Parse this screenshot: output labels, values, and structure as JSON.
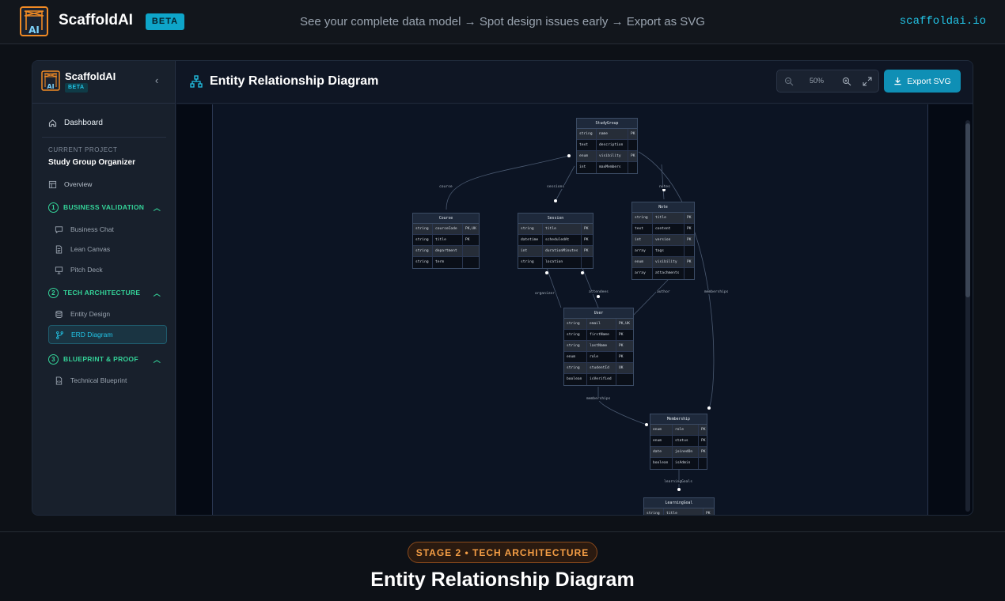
{
  "topbar": {
    "brand": "ScaffoldAI",
    "badge": "BETA",
    "tagline": "See your complete data model → Spot design issues early → Export as SVG",
    "site": "scaffoldai.io"
  },
  "sidebar": {
    "brand": "ScaffoldAI",
    "badge": "BETA",
    "dashboard": "Dashboard",
    "current_project_label": "CURRENT PROJECT",
    "project_name": "Study Group Organizer",
    "overview": "Overview",
    "sections": [
      {
        "num": "1",
        "label": "BUSINESS VALIDATION",
        "items": [
          "Business Chat",
          "Lean Canvas",
          "Pitch Deck"
        ]
      },
      {
        "num": "2",
        "label": "TECH ARCHITECTURE",
        "items": [
          "Entity Design",
          "ERD Diagram"
        ]
      },
      {
        "num": "3",
        "label": "BLUEPRINT & PROOF",
        "items": [
          "Technical Blueprint"
        ]
      }
    ],
    "active_item": "ERD Diagram"
  },
  "main": {
    "title": "Entity Relationship Diagram",
    "zoom": "50%",
    "export_label": "Export SVG"
  },
  "erd": {
    "tables": [
      {
        "name": "StudyGroup",
        "rows": [
          [
            "string",
            "name",
            "PK"
          ],
          [
            "text",
            "description",
            ""
          ],
          [
            "enum",
            "visibility",
            "PK"
          ],
          [
            "int",
            "maxMembers",
            ""
          ]
        ]
      },
      {
        "name": "Course",
        "rows": [
          [
            "string",
            "courseCode",
            "PK,UK"
          ],
          [
            "string",
            "title",
            "PK"
          ],
          [
            "string",
            "department",
            ""
          ],
          [
            "string",
            "term",
            ""
          ]
        ]
      },
      {
        "name": "Session",
        "rows": [
          [
            "string",
            "title",
            "PK"
          ],
          [
            "datetime",
            "scheduledAt",
            "PK"
          ],
          [
            "int",
            "durationMinutes",
            "PK"
          ],
          [
            "string",
            "location",
            ""
          ]
        ]
      },
      {
        "name": "Note",
        "rows": [
          [
            "string",
            "title",
            "PK"
          ],
          [
            "text",
            "content",
            "PK"
          ],
          [
            "int",
            "version",
            "PK"
          ],
          [
            "array",
            "tags",
            ""
          ],
          [
            "enum",
            "visibility",
            "PK"
          ],
          [
            "array",
            "attachments",
            ""
          ]
        ]
      },
      {
        "name": "User",
        "rows": [
          [
            "string",
            "email",
            "PK,UK"
          ],
          [
            "string",
            "firstName",
            "PK"
          ],
          [
            "string",
            "lastName",
            "PK"
          ],
          [
            "enum",
            "role",
            "PK"
          ],
          [
            "string",
            "studentId",
            "UK"
          ],
          [
            "boolean",
            "isVerified",
            ""
          ]
        ]
      },
      {
        "name": "Membership",
        "rows": [
          [
            "enum",
            "role",
            "PK"
          ],
          [
            "enum",
            "status",
            "PK"
          ],
          [
            "date",
            "joinedOn",
            "PK"
          ],
          [
            "boolean",
            "isAdmin",
            ""
          ]
        ]
      },
      {
        "name": "LearningGoal",
        "rows": [
          [
            "string",
            "title",
            "PK"
          ]
        ]
      }
    ],
    "relations": [
      "course",
      "sessions",
      "notes",
      "organizer",
      "attendees",
      "author",
      "memberships",
      "memberships",
      "learningGoals"
    ]
  },
  "footer": {
    "stage": "STAGE 2 • TECH ARCHITECTURE",
    "title": "Entity Relationship Diagram"
  }
}
